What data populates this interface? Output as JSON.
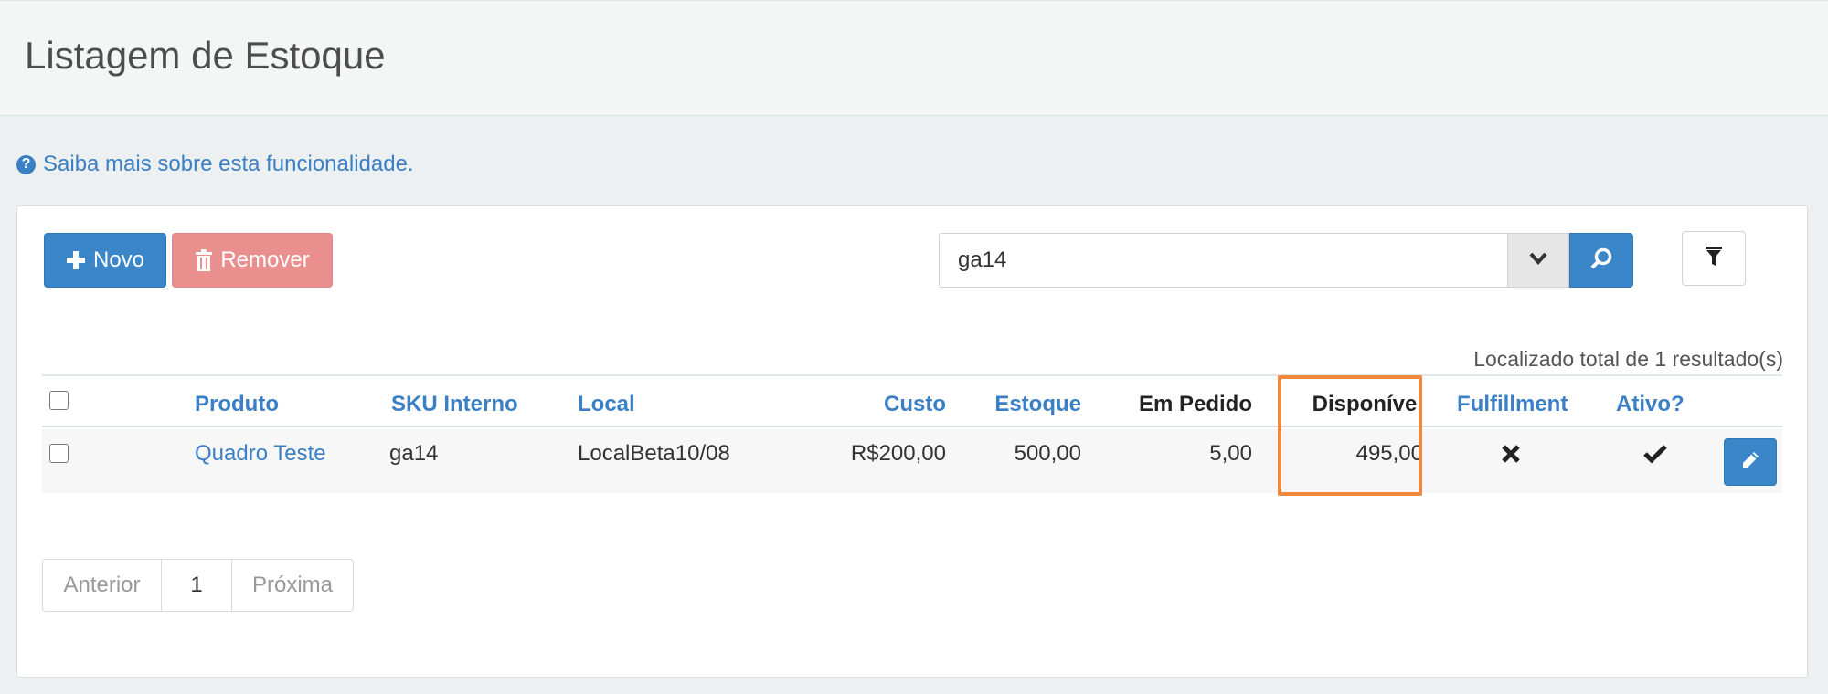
{
  "header": {
    "title": "Listagem de Estoque"
  },
  "help": {
    "text": "Saiba mais sobre esta funcionalidade."
  },
  "toolbar": {
    "new_label": "Novo",
    "remove_label": "Remover",
    "search_value": "ga14"
  },
  "results": {
    "summary": "Localizado total de 1 resultado(s)"
  },
  "table": {
    "columns": {
      "produto": "Produto",
      "sku": "SKU Interno",
      "local": "Local",
      "custo": "Custo",
      "estoque": "Estoque",
      "em_pedido": "Em Pedido",
      "disponivel": "Disponível",
      "fulfillment": "Fulfillment",
      "ativo": "Ativo?"
    },
    "rows": [
      {
        "produto": "Quadro Teste",
        "sku": "ga14",
        "local": "LocalBeta10/08",
        "custo": "R$200,00",
        "estoque": "500,00",
        "em_pedido": "5,00",
        "disponivel": "495,00",
        "fulfillment_icon": "times-icon",
        "ativo_icon": "check-icon"
      }
    ]
  },
  "pagination": {
    "prev": "Anterior",
    "current": "1",
    "next": "Próxima"
  },
  "colors": {
    "primary": "#3a86c8",
    "danger_light": "#e9908f",
    "link": "#3b7fc4",
    "highlight": "#f0883f"
  }
}
